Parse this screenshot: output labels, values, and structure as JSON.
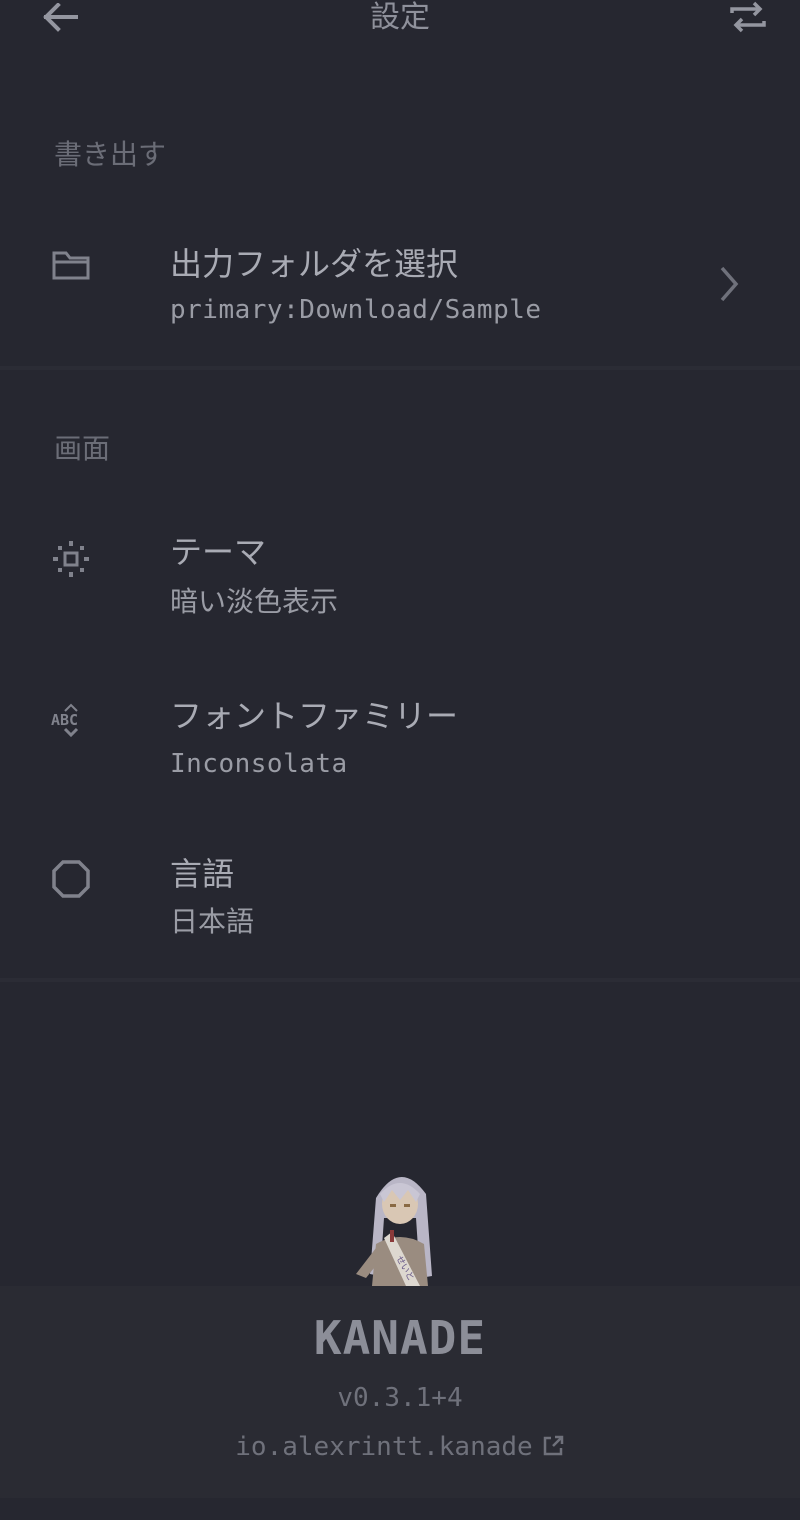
{
  "appbar": {
    "title": "設定",
    "back_icon": "arrow-left-icon",
    "action_icon": "swap-icon"
  },
  "sections": {
    "export": {
      "header": "書き出す",
      "items": [
        {
          "icon": "folder-icon",
          "title": "出力フォルダを選択",
          "subtitle": "primary:Download/Sample"
        }
      ]
    },
    "display": {
      "header": "画面",
      "items": [
        {
          "icon": "theme-icon",
          "title": "テーマ",
          "subtitle": "暗い淡色表示"
        },
        {
          "icon": "font-icon",
          "title": "フォントファミリー",
          "subtitle": "Inconsolata"
        },
        {
          "icon": "language-icon",
          "title": "言語",
          "subtitle": "日本語"
        }
      ]
    }
  },
  "footer": {
    "logo": "KANADE",
    "version": "v0.3.1+4",
    "package": "io.alexrintt.kanade",
    "package_icon": "external-link-icon"
  },
  "colors": {
    "background": "#262730",
    "footer_background": "#2a2b33",
    "text_primary": "#a9abb4",
    "text_muted": "#6b6d77"
  }
}
